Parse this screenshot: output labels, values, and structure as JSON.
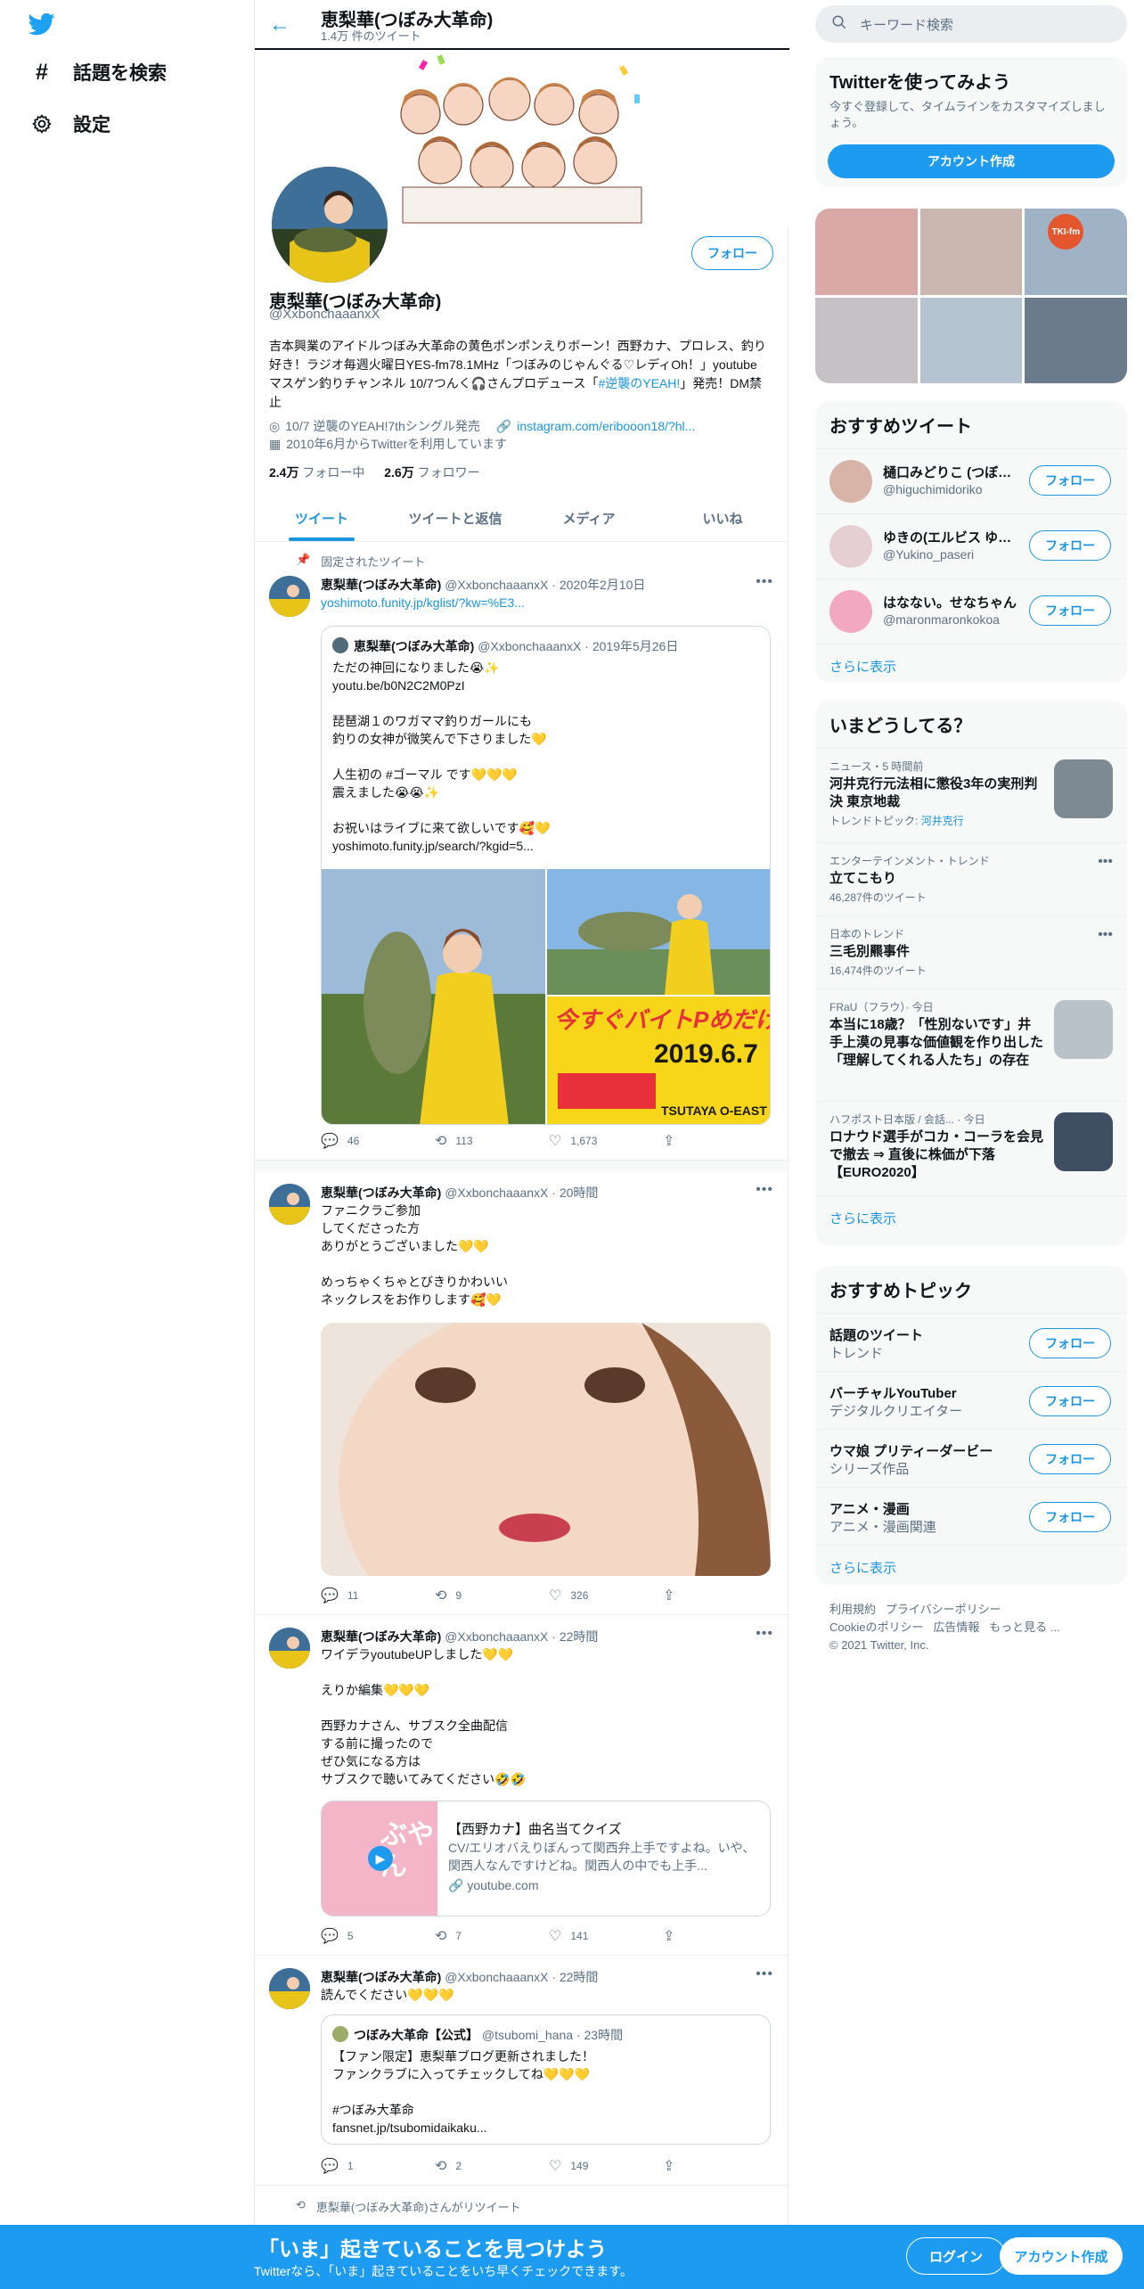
{
  "nav": {
    "explore": "話題を検索",
    "settings": "設定"
  },
  "header": {
    "name": "恵梨華(つぼみ大革命)",
    "count": "1.4万 件のツイート"
  },
  "profile": {
    "follow": "フォロー",
    "name": "恵梨華(つぼみ大革命)",
    "handle": "@XxbonchaaanxX",
    "bio_main": "吉本興業のアイドルつぼみ大革命の黄色ポンポンえりボーン！西野カナ、プロレス、釣り好き！ラジオ毎週火曜日YES-fm78.1MHz「つぼみのじゃんぐる♡レディOh！」youtube マスゲン釣りチャンネル 10/7つんく🎧さんプロデュース「",
    "bio_link": "#逆襲のYEAH!",
    "bio_end": "」発売！DM禁止",
    "location": "10/7 逆襲のYEAH!7thシングル発売",
    "url": "instagram.com/eribooon18/?hl...",
    "joined": "2010年6月からTwitterを利用しています",
    "following_num": "2.4万",
    "following_label": "フォロー中",
    "followers_num": "2.6万",
    "followers_label": "フォロワー"
  },
  "tabs": [
    "ツイート",
    "ツイートと返信",
    "メディア",
    "いいね"
  ],
  "tweets": [
    {
      "pinned": "固定されたツイート",
      "name": "恵梨華(つぼみ大革命)",
      "handle": "@XxbonchaaanxX",
      "time": "2020年2月10日",
      "link": "yoshimoto.funity.jp/kglist/?kw=%E3...",
      "quote": {
        "name": "恵梨華(つぼみ大革命)",
        "handle": "@XxbonchaaanxX",
        "time": "2019年5月26日",
        "text": "ただの神回になりました😭✨\nyoutu.be/b0N2C2M0PzI\n\n琵琶湖１のワガママ釣りガールにも\n釣りの女神が微笑んで下さりました💛\n\n人生初の #ゴーマル です💛💛💛\n震えました😭😭✨\n\nお祝いはライブに来て欲しいです🥰💛\nyoshimoto.funity.jp/search/?kgid=5...",
        "poster_title": "今すぐバイトPめだけ！",
        "poster_date": "2019.6.7",
        "poster_venue": "TSUTAYA O-EAST"
      },
      "replies": "46",
      "retweets": "113",
      "likes": "1,673"
    },
    {
      "name": "恵梨華(つぼみ大革命)",
      "handle": "@XxbonchaaanxX",
      "time": "20時間",
      "text": "ファニクラご参加\nしてくださった方\nありがとうございました💛💛\n\nめっちゃくちゃとびきりかわいい\nネックレスをお作りします🥰💛",
      "replies": "11",
      "retweets": "9",
      "likes": "326"
    },
    {
      "name": "恵梨華(つぼみ大革命)",
      "handle": "@XxbonchaaanxX",
      "time": "22時間",
      "text": "ワイデラyoutubeUPしました💛💛\n\nえりか編集💛💛💛\n\n西野カナさん、サブスク全曲配信\nする前に撮ったので\nぜひ気になる方は\nサブスクで聴いてみてください🤣🤣",
      "card_title": "【西野カナ】曲名当てクイズ",
      "card_desc": "CV/エリオバえりぼんって関西弁上手ですよね。いや、関西人なんですけどね。関西人の中でも上手...",
      "card_domain": "youtube.com",
      "card_thumb": "ぶやん",
      "replies": "5",
      "retweets": "7",
      "likes": "141"
    },
    {
      "name": "恵梨華(つぼみ大革命)",
      "handle": "@XxbonchaaanxX",
      "time": "22時間",
      "text": "読んでください💛💛💛",
      "quote": {
        "name": "つぼみ大革命【公式】",
        "handle": "@tsubomi_hana",
        "time": "23時間",
        "text": "【ファン限定】恵梨華ブログ更新されました！\nファンクラブに入ってチェックしてね💛💛💛\n\n#つぼみ大革命\nfansnet.jp/tsubomidaikaku..."
      },
      "replies": "1",
      "retweets": "2",
      "likes": "149"
    }
  ],
  "retweeted_label": "恵梨華(つぼみ大革命)さんがリツイート",
  "right": {
    "search_placeholder": "キーワード検索",
    "signup": {
      "title": "Twitterを使ってみよう",
      "desc": "今すぐ登録して、タイムラインをカスタマイズしましょう。",
      "button": "アカウント作成"
    },
    "photo_sign": "TKI-fm",
    "who": {
      "title": "おすすめツイート",
      "users": [
        {
          "name": "樋口みどりこ (つぼみ大革命)",
          "handle": "@higuchimidoriko",
          "follow": "フォロー"
        },
        {
          "name": "ゆきの(エルビス ゆきの)",
          "handle": "@Yukino_paseri",
          "follow": "フォロー"
        },
        {
          "name": "はなない。せなちゃん",
          "handle": "@maronmaronkokoa",
          "follow": "フォロー"
        }
      ],
      "more": "さらに表示"
    },
    "trends": {
      "title": "いまどうしてる？",
      "items": [
        {
          "cat": "ニュース・5 時間前",
          "title": "河井克行元法相に懲役3年の実刑判決 東京地裁",
          "sub_label": "トレンドトピック:",
          "sub_link": "河井克行"
        },
        {
          "cat": "エンターテインメント・トレンド",
          "title": "立てこもり",
          "sub": "46,287件のツイート"
        },
        {
          "cat": "日本のトレンド",
          "title": "三毛別羆事件",
          "sub": "16,474件のツイート"
        },
        {
          "cat": "FRaU（フラウ）· 今日",
          "title": "本当に18歳？「性別ないです」井手上漠の見事な価値観を作り出した「理解してくれる人たち」の存在"
        },
        {
          "cat": "ハフポスト日本版 / 会話... · 今日",
          "title": "ロナウド選手がコカ・コーラを会見で撤去 ⇒ 直後に株価が下落【EURO2020】"
        }
      ],
      "more": "さらに表示"
    },
    "topics": {
      "title": "おすすめトピック",
      "items": [
        {
          "name": "話題のツイート",
          "sub": "トレンド",
          "follow": "フォロー"
        },
        {
          "name": "バーチャルYouTuber",
          "sub": "デジタルクリエイター",
          "follow": "フォロー"
        },
        {
          "name": "ウマ娘 プリティーダービー",
          "sub": "シリーズ作品",
          "follow": "フォロー"
        },
        {
          "name": "アニメ・漫画",
          "sub": "アニメ・漫画関連",
          "follow": "フォロー"
        }
      ],
      "more": "さらに表示"
    },
    "footer": {
      "terms": "利用規約",
      "privacy": "プライバシーポリシー",
      "cookie": "Cookieのポリシー",
      "ads": "広告情報",
      "more": "もっと見る ...",
      "copyright": "© 2021 Twitter, Inc."
    }
  },
  "bottom": {
    "title": "「いま」起きていることを見つけよう",
    "sub": "Twitterなら、「いま」起きていることをいち早くチェックできます。",
    "login": "ログイン",
    "signup": "アカウント作成"
  },
  "colors": {
    "accent": "#1b95e0",
    "bottom_bar": "#1d9bf0"
  }
}
